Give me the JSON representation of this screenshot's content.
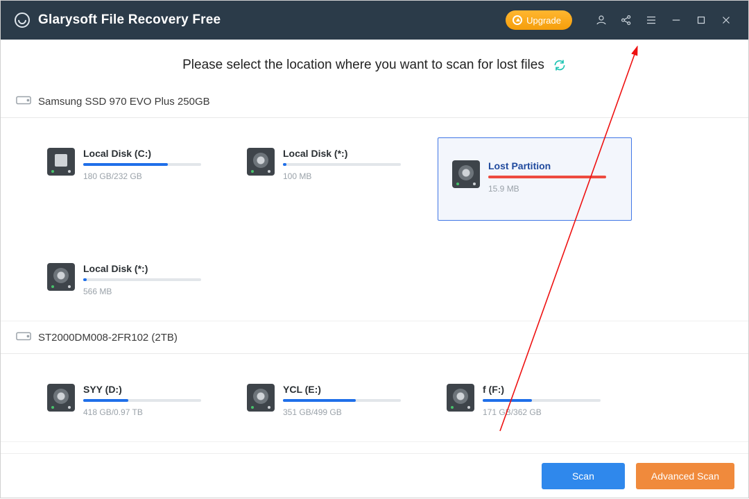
{
  "app": {
    "title": "Glarysoft File Recovery Free"
  },
  "titlebar": {
    "upgrade_label": "Upgrade"
  },
  "instruction": "Please select the location where you want to scan for lost files",
  "footer": {
    "scan_label": "Scan",
    "advanced_label": "Advanced Scan"
  },
  "disks": [
    {
      "name": "Samsung SSD 970 EVO Plus 250GB",
      "partitions": [
        {
          "name": "Local Disk (C:)",
          "size": "180 GB/232 GB",
          "fill": 72,
          "color": "blue",
          "win": true,
          "selected": false
        },
        {
          "name": "Local Disk (*:)",
          "size": "100 MB",
          "fill": 3,
          "color": "blue",
          "win": false,
          "selected": false
        },
        {
          "name": "Lost Partition",
          "size": "15.9 MB",
          "fill": 100,
          "color": "red",
          "win": false,
          "selected": true
        },
        {
          "name": "Local Disk (*:)",
          "size": "566 MB",
          "fill": 3,
          "color": "blue",
          "win": false,
          "selected": false
        }
      ]
    },
    {
      "name": "ST2000DM008-2FR102 (2TB)",
      "partitions": [
        {
          "name": "SYY (D:)",
          "size": "418 GB/0.97 TB",
          "fill": 38,
          "color": "blue",
          "win": false,
          "selected": false
        },
        {
          "name": "YCL (E:)",
          "size": "351 GB/499 GB",
          "fill": 62,
          "color": "blue",
          "win": false,
          "selected": false
        },
        {
          "name": "f (F:)",
          "size": "171 GB/362 GB",
          "fill": 42,
          "color": "blue",
          "win": false,
          "selected": false
        }
      ]
    }
  ]
}
